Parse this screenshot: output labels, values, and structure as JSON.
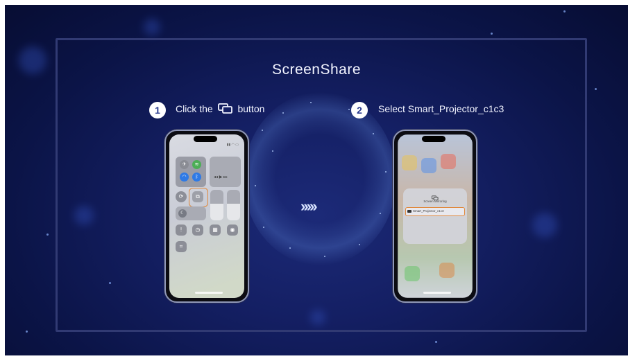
{
  "title": "ScreenShare",
  "steps": [
    {
      "number": "1",
      "text_before": "Click the",
      "icon": "screen-mirroring-icon",
      "text_after": "button"
    },
    {
      "number": "2",
      "text": "Select Smart_Projector_c1c3"
    }
  ],
  "phone2": {
    "panel_title": "Screen Mirroring",
    "device_label": "Smart_Projector_c1c3"
  },
  "colors": {
    "background": "#0b1447",
    "accent_highlight": "#e0883a",
    "step_badge": "#ffffff"
  }
}
